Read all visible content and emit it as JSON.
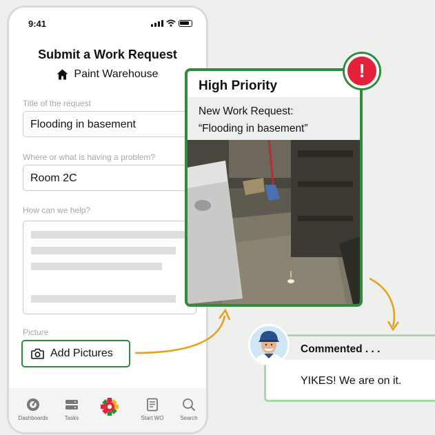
{
  "status_bar": {
    "time": "9:41"
  },
  "form": {
    "title": "Submit a Work Request",
    "location": "Paint Warehouse",
    "fields": [
      {
        "label": "Title of the request",
        "value": "Flooding in basement"
      },
      {
        "label": "Where or what is having a problem?",
        "value": "Room 2C"
      },
      {
        "label": "How can we help?",
        "value": ""
      }
    ],
    "picture_label": "Picture",
    "add_pictures_label": "Add Pictures"
  },
  "tab_bar": {
    "items": [
      {
        "label": "Dashboards",
        "icon": "dashboard-gauge-icon"
      },
      {
        "label": "Tasks",
        "icon": "tasks-stack-icon"
      },
      {
        "label": "",
        "icon": "app-logo-icon"
      },
      {
        "label": "Start WO",
        "icon": "start-work-order-icon"
      },
      {
        "label": "Search",
        "icon": "search-icon"
      }
    ]
  },
  "alert": {
    "title": "High Priority",
    "line1": "New Work Request:",
    "line2": "“Flooding in basement”",
    "badge": "!"
  },
  "comment": {
    "header": "Commented . . .",
    "text": "YIKES! We are on it."
  },
  "colors": {
    "accent_green": "#2e8b3c",
    "alert_red": "#e4213b",
    "arrow_orange": "#e8a020",
    "comment_border": "#a6d8a9"
  }
}
